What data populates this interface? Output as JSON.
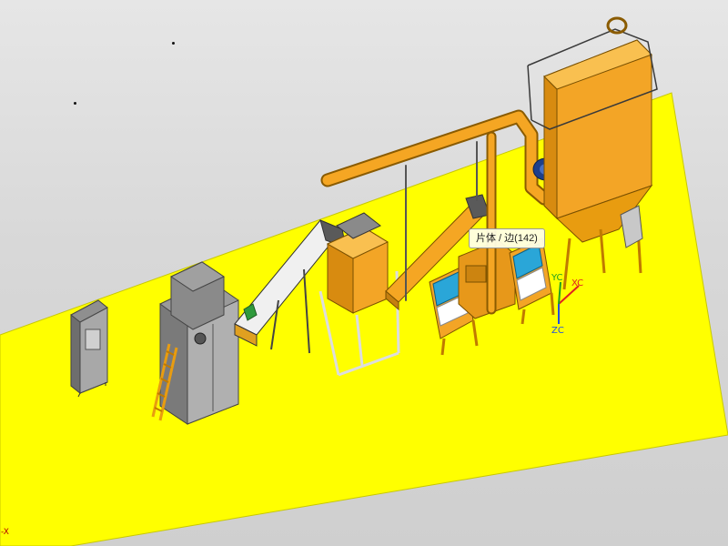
{
  "viewport": {
    "tooltip": "片体 / 边(142)",
    "axis_labels": {
      "x": "XC",
      "y": "YC",
      "z": "ZC"
    },
    "corner_label": "-X"
  },
  "colors": {
    "background": "#d8d8d8",
    "floor": "#ffff00",
    "machine_orange": "#f5a623",
    "machine_grey": "#8c8c8c",
    "panel_grey": "#a8a8a8",
    "axis_x": "#e02020",
    "axis_y": "#20a020",
    "axis_z": "#2050e0"
  },
  "equipment": [
    {
      "name": "control-cabinet",
      "color": "grey"
    },
    {
      "name": "shredder",
      "color": "grey"
    },
    {
      "name": "belt-conveyor",
      "color": "orange"
    },
    {
      "name": "crusher",
      "color": "orange"
    },
    {
      "name": "inclined-conveyor",
      "color": "orange"
    },
    {
      "name": "separator-left",
      "color": "orange"
    },
    {
      "name": "separator-right",
      "color": "orange"
    },
    {
      "name": "air-duct",
      "color": "orange"
    },
    {
      "name": "cyclone-fan",
      "color": "blue"
    },
    {
      "name": "dust-collector",
      "color": "orange"
    }
  ]
}
